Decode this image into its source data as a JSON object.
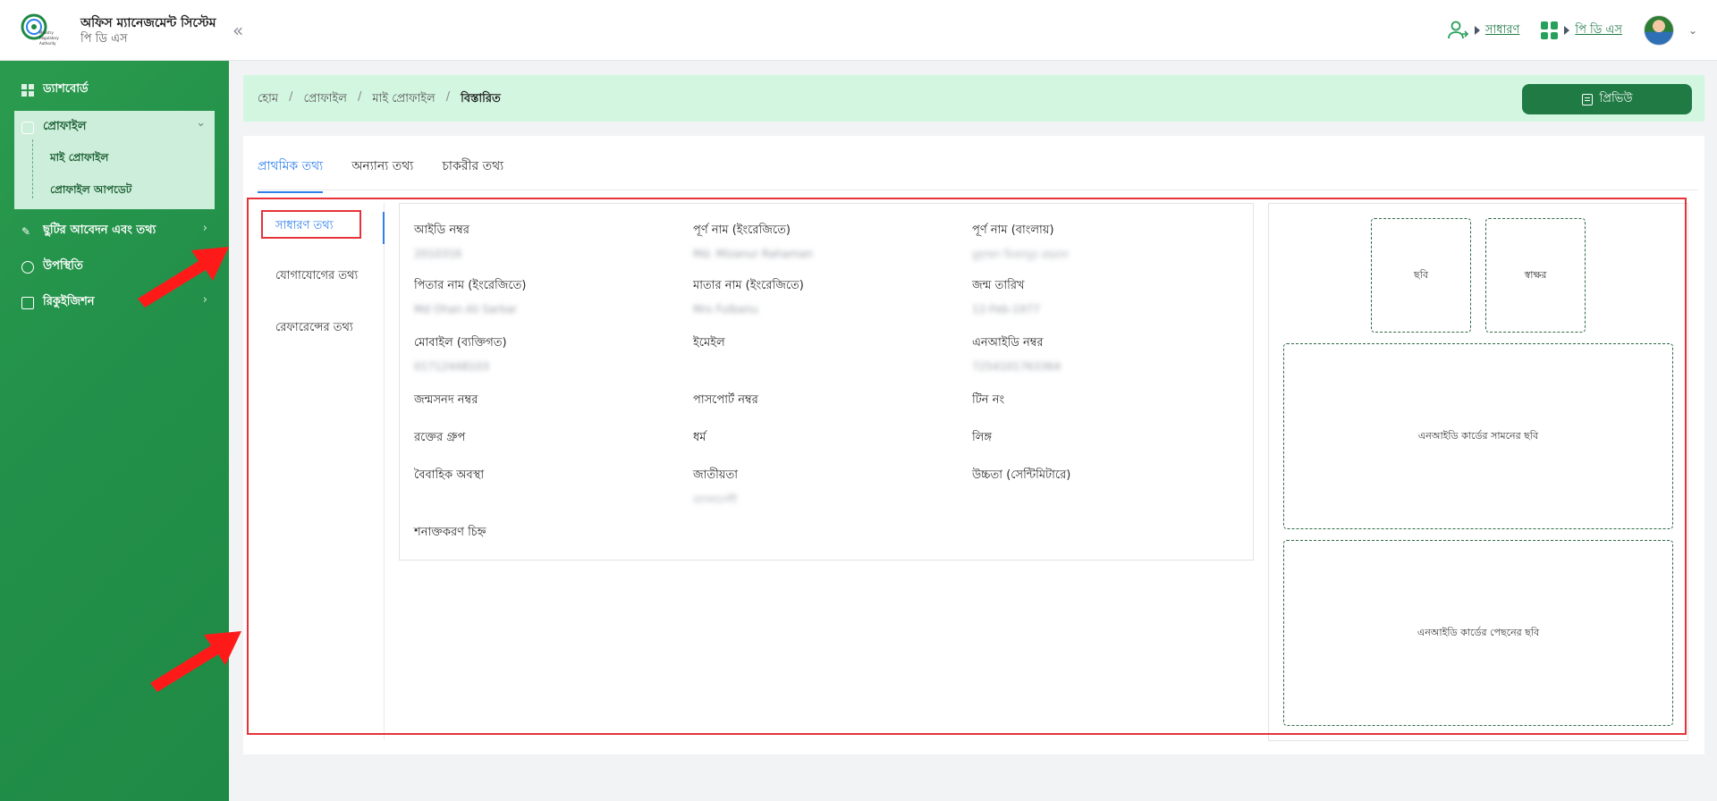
{
  "header": {
    "app_title": "অফিস ম্যানেজমেন্ট সিস্টেম",
    "app_subtitle": "পি ডি এস",
    "logo_text": "Ministry Regulatory Authority",
    "role_link": "সাধারণ",
    "module_link": "পি ডি এস"
  },
  "sidebar": {
    "dashboard": "ড্যাশবোর্ড",
    "profile": "প্রোফাইল",
    "my_profile": "মাই প্রোফাইল",
    "profile_update": "প্রোফাইল আপডেট",
    "leave": "ছুটির আবেদন এবং তথ্য",
    "attendance": "উপস্থিতি",
    "requisition": "রিকুইজিশন"
  },
  "breadcrumb": {
    "home": "হোম",
    "profile": "প্রোফাইল",
    "my_profile": "মাই প্রোফাইল",
    "current": "বিস্তারিত",
    "sep": "/"
  },
  "preview_button": "প্রিভিউ",
  "tabs": [
    "প্রাথমিক তথ্য",
    "অন্যান্য তথ্য",
    "চাকরীর তথ্য"
  ],
  "vnav": [
    "সাধারণ তথ্য",
    "যোগাযোগের তথ্য",
    "রেফারেন্সের তথ্য"
  ],
  "fields": [
    {
      "label": "আইডি নম্বর",
      "value": "2010316"
    },
    {
      "label": "পূর্ণ নাম (ইংরেজিতে)",
      "value": "Md. Mizanur Rahaman"
    },
    {
      "label": "পূর্ণ নাম (বাংলায়)",
      "value": "মুহাম্মদ মিজানুর রহমান"
    },
    {
      "label": "পিতার নাম (ইংরেজিতে)",
      "value": "Md Ohan Ali Sarkar"
    },
    {
      "label": "মাতার নাম (ইংরেজিতে)",
      "value": "Mrs Fulbanu"
    },
    {
      "label": "জন্ম তারিখ",
      "value": "12-Feb-1977"
    },
    {
      "label": "মোবাইল (ব্যক্তিগত)",
      "value": "01712448103"
    },
    {
      "label": "ইমেইল",
      "value": ""
    },
    {
      "label": "এনআইডি নম্বর",
      "value": "7254101763364"
    },
    {
      "label": "জন্মসনদ নম্বর",
      "value": ""
    },
    {
      "label": "পাসপোর্ট নম্বর",
      "value": ""
    },
    {
      "label": "টিন নং",
      "value": ""
    },
    {
      "label": "রক্তের গ্রুপ",
      "value": ""
    },
    {
      "label": "ধর্ম",
      "value": ""
    },
    {
      "label": "লিঙ্গ",
      "value": ""
    },
    {
      "label": "বৈবাহিক অবস্থা",
      "value": ""
    },
    {
      "label": "জাতীয়তা",
      "value": "বাংলাদেশী"
    },
    {
      "label": "উচ্চতা (সেন্টিমিটারে)",
      "value": ""
    },
    {
      "label": "শনাক্তকরণ চিহ্ন",
      "value": ""
    }
  ],
  "media": {
    "photo": "ছবি",
    "signature": "স্বাক্ষর",
    "nid_front": "এনআইডি কার্ডের সামনের ছবি",
    "nid_back": "এনআইডি কার্ডের পেছনের ছবি"
  },
  "colors": {
    "accent": "#2f80ed",
    "brand_green": "#1f7a44",
    "highlight_red": "#e8323a"
  }
}
